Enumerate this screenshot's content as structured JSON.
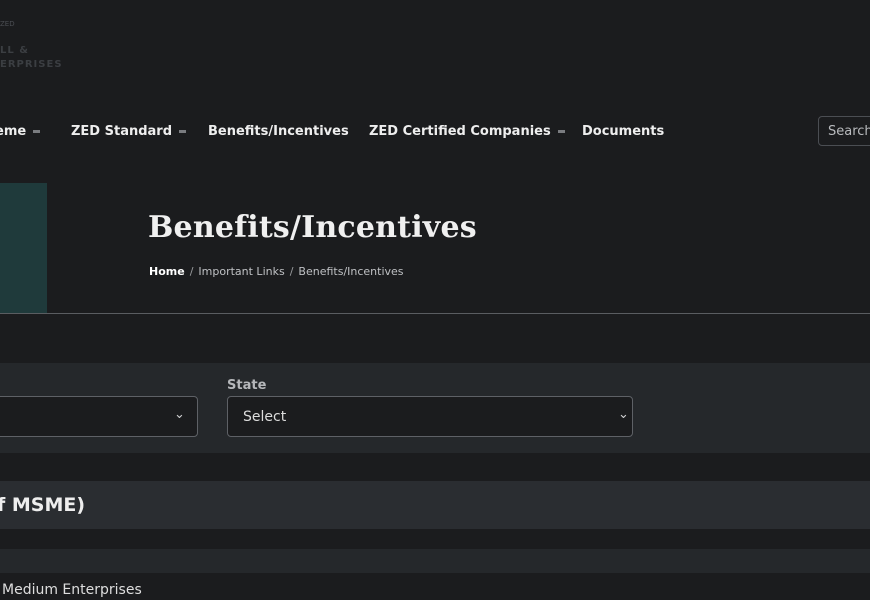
{
  "logo": {
    "tagline": "ZED",
    "line1": "LL &",
    "line2": "ERPRISES"
  },
  "nav": {
    "items": [
      {
        "label": "eme"
      },
      {
        "label": "ZED Standard"
      },
      {
        "label": "Benefits/Incentives"
      },
      {
        "label": "ZED Certified Companies"
      },
      {
        "label": "Documents"
      }
    ],
    "search_placeholder": "Search"
  },
  "hero": {
    "title": "Benefits/Incentives",
    "breadcrumb": [
      "Home",
      "Important Links",
      "Benefits/Incentives"
    ]
  },
  "filters": {
    "left_select_value": "",
    "state_label": "State",
    "state_select_value": "Select"
  },
  "section": {
    "heading": "f MSME)"
  },
  "row": {
    "text": "Medium Enterprises"
  },
  "colors": {
    "background": "#1b1c1e",
    "panel": "#25282b",
    "accent": "#1f3a3b"
  }
}
